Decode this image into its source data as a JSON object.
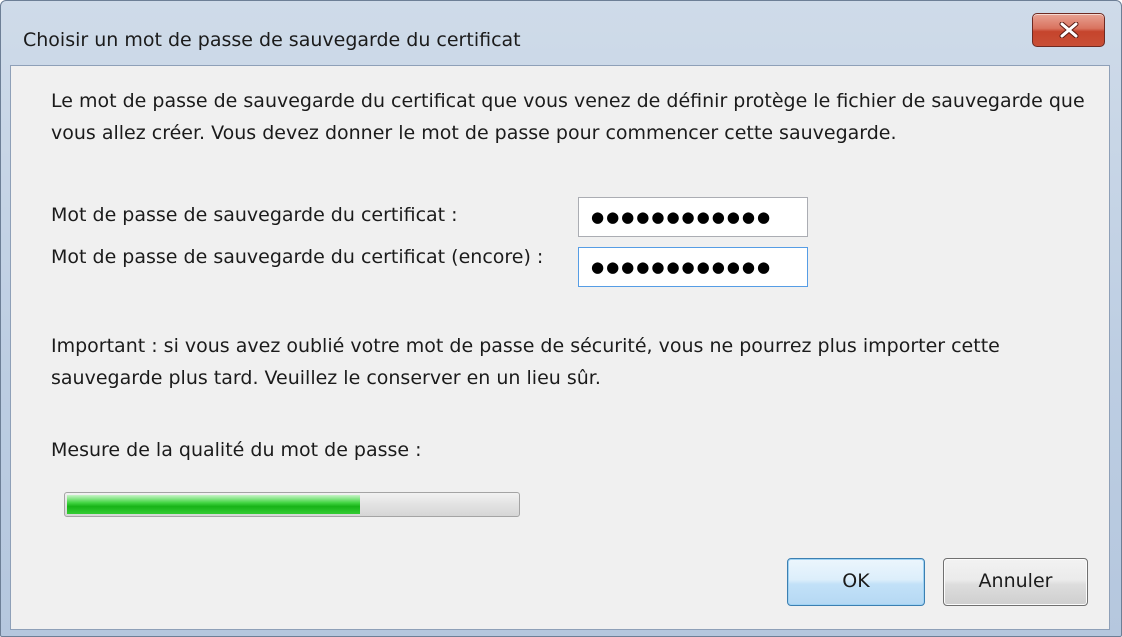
{
  "window": {
    "title": "Choisir un mot de passe de sauvegarde du certificat",
    "close_icon": "close-icon"
  },
  "dialog": {
    "description": "Le mot de passe de sauvegarde du certificat que vous venez de définir protège le fichier de sauvegarde que vous allez créer. Vous devez donner le mot de passe pour commencer cette sauvegarde.",
    "password_label": "Mot de passe de sauvegarde du certificat :",
    "password_value": "●●●●●●●●●●●●",
    "password_confirm_label": "Mot de passe de sauvegarde du certificat (encore) :",
    "password_confirm_value": "●●●●●●●●●●●●",
    "important_text": "Important : si vous avez oublié votre mot de passe de sécurité, vous ne pourrez plus importer cette sauvegarde plus tard. Veuillez le conserver en un lieu sûr.",
    "quality_label": "Mesure de la qualité du mot de passe :",
    "quality_fraction": 0.65
  },
  "buttons": {
    "ok_label": "OK",
    "cancel_label": "Annuler"
  },
  "colors": {
    "meter_fill": "#18b418",
    "close_button": "#c5442c",
    "focus_border": "#569de5"
  }
}
